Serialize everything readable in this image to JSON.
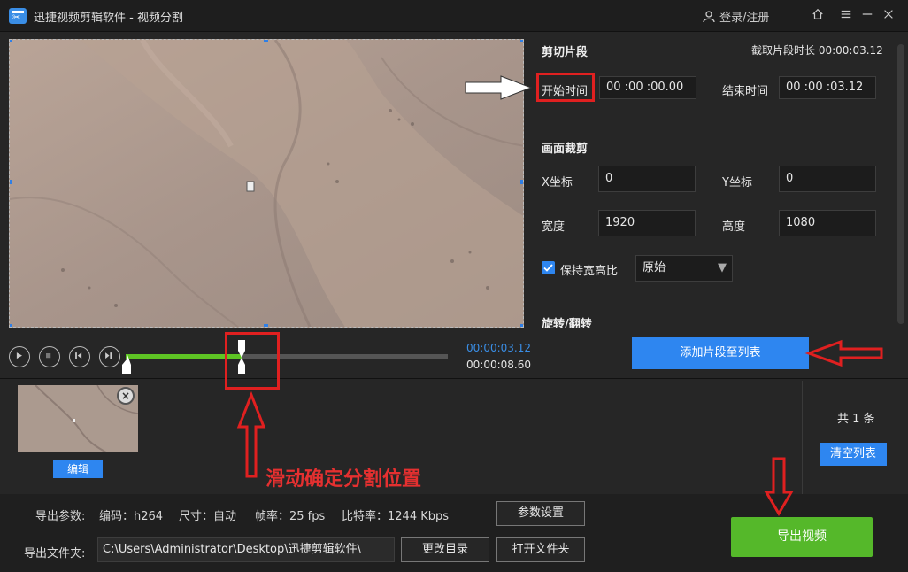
{
  "titlebar": {
    "title": "迅捷视频剪辑软件 - 视频分割",
    "login": "登录/注册",
    "home_icon": "home-icon",
    "min_icon": "minimize-icon",
    "close_icon": "close-icon"
  },
  "cut_segment": {
    "section_title": "剪切片段",
    "duration_label": "截取片段时长 00:00:03.12",
    "start_label": "开始时间",
    "start_value": "00 :00 :00.00",
    "end_label": "结束时间",
    "end_value": "00 :00 :03.12"
  },
  "crop": {
    "section_title": "画面裁剪",
    "x_label": "X坐标",
    "x_value": "0",
    "y_label": "Y坐标",
    "y_value": "0",
    "width_label": "宽度",
    "width_value": "1920",
    "height_label": "高度",
    "height_value": "1080",
    "keep_ratio_label": "保持宽高比",
    "keep_ratio_checked": true,
    "ratio_select": "原始"
  },
  "rotate": {
    "section_title": "旋转/翻转"
  },
  "player": {
    "current_time": "00:00:03.12",
    "total_time": "00:00:08.60",
    "progress_fraction": 0.36
  },
  "add_to_list": "添加片段至列表",
  "clip_list": {
    "edit_label": "编辑",
    "count_label": "共 1 条",
    "clear_label": "清空列表"
  },
  "export": {
    "params_label": "导出参数:",
    "codec": "编码：h264",
    "size": "尺寸：自动",
    "fps": "帧率：25 fps",
    "bitrate": "比特率：1244 Kbps",
    "params_button": "参数设置",
    "folder_label": "导出文件夹:",
    "folder_path": "C:\\Users\\Administrator\\Desktop\\迅捷剪辑软件\\",
    "change_dir": "更改目录",
    "open_folder": "打开文件夹",
    "export_button": "导出视频"
  },
  "annotation": {
    "text": "滑动确定分割位置"
  },
  "colors": {
    "accent_blue": "#2e86f0",
    "export_green": "#55b82a",
    "progress_green": "#5ec424",
    "annotation_red": "#e02020"
  }
}
